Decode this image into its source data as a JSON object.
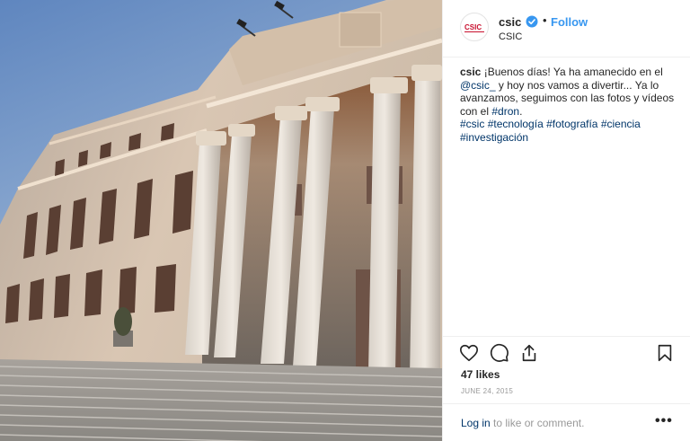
{
  "post": {
    "username": "csic",
    "follow_label": "Follow",
    "separator": "•",
    "location": "CSIC",
    "avatar_text": "CSIC",
    "caption": {
      "author": "csic",
      "line1": "¡Buenos días! Ya ha amanecido en el",
      "mention": "@csic_",
      "line2": " y hoy nos vamos a divertir... Ya lo avanzamos, seguimos con las fotos y vídeos con el ",
      "tag_dron": "#dron",
      "tag_dot": ".",
      "tags": [
        "#csic",
        "#tecnología",
        "#fotografía",
        "#ciencia",
        "#investigación"
      ]
    },
    "likes": "47 likes",
    "date": "JUNE 24, 2015",
    "login_link": "Log in",
    "login_rest": " to like or comment.",
    "more_label": "•••"
  },
  "icons": {
    "verified": "verified-badge-icon",
    "like": "heart-icon",
    "comment": "comment-icon",
    "share": "share-icon",
    "save": "bookmark-icon"
  },
  "colors": {
    "link": "#003569",
    "follow": "#3897f0",
    "muted": "#999999",
    "verified": "#3897f0"
  }
}
